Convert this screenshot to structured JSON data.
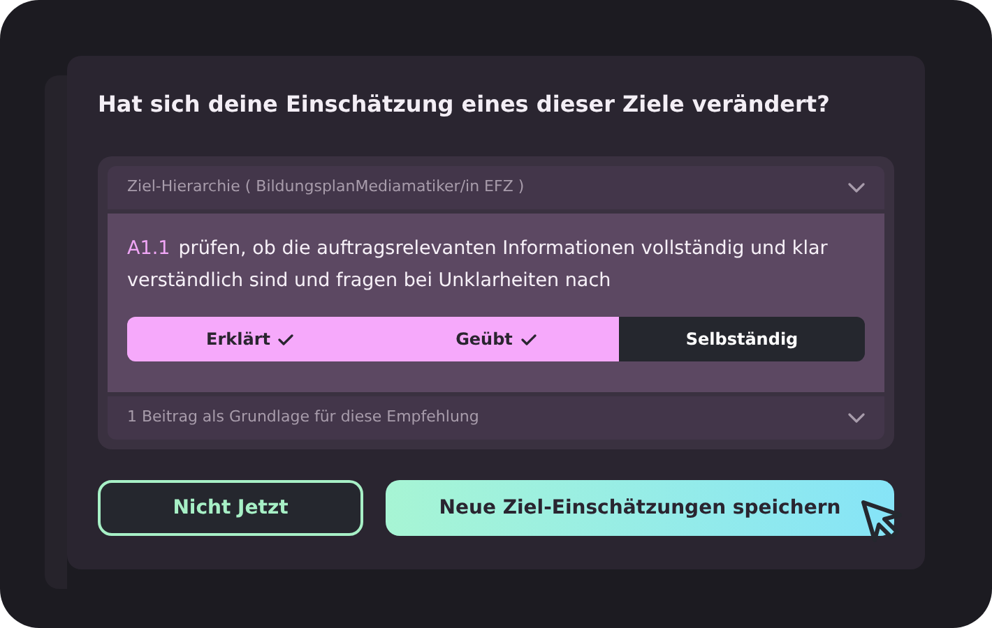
{
  "title": "Hat sich deine Einschätzung eines dieser Ziele verändert?",
  "hierarchy": {
    "label": "Ziel-Hierarchie ( BildungsplanMediamatiker/in EFZ )",
    "expanded": false
  },
  "goal": {
    "code": "A1.1",
    "text": "prüfen, ob die auftragsrelevanten Informationen vollständig und klar verständlich sind und fragen bei Unklarheiten nach"
  },
  "levels": [
    {
      "label": "Erklärt",
      "checked": true
    },
    {
      "label": "Geübt",
      "checked": true
    },
    {
      "label": "Selbständig",
      "checked": false
    }
  ],
  "basis": {
    "label": "1 Beitrag als Grundlage für diese Empfehlung",
    "expanded": false
  },
  "buttons": {
    "secondary": "Nicht Jetzt",
    "primary": "Neue Ziel-Einschätzungen speichern"
  }
}
